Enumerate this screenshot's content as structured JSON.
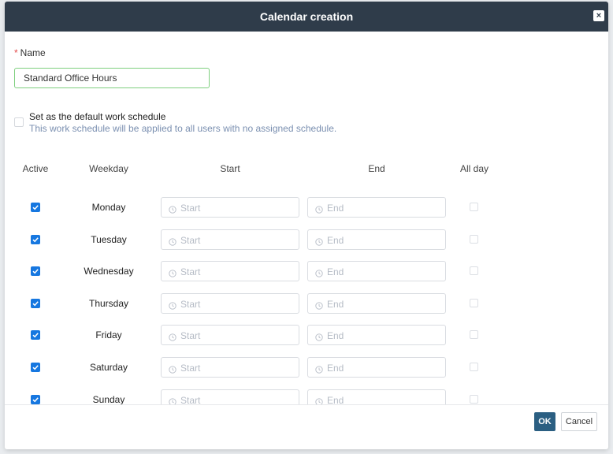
{
  "dialog": {
    "title": "Calendar creation",
    "close_label": "×"
  },
  "name_field": {
    "required_mark": "*",
    "label": "Name",
    "value": "Standard Office Hours"
  },
  "default_schedule": {
    "checked": false,
    "title": "Set as the default work schedule",
    "description": "This work schedule will be applied to all users with no assigned schedule."
  },
  "columns": {
    "active": "Active",
    "weekday": "Weekday",
    "start": "Start",
    "end": "End",
    "all_day": "All day"
  },
  "days": [
    {
      "name": "Monday",
      "active": true,
      "start_placeholder": "Start",
      "end_placeholder": "End",
      "all_day": false
    },
    {
      "name": "Tuesday",
      "active": true,
      "start_placeholder": "Start",
      "end_placeholder": "End",
      "all_day": false
    },
    {
      "name": "Wednesday",
      "active": true,
      "start_placeholder": "Start",
      "end_placeholder": "End",
      "all_day": false
    },
    {
      "name": "Thursday",
      "active": true,
      "start_placeholder": "Start",
      "end_placeholder": "End",
      "all_day": false
    },
    {
      "name": "Friday",
      "active": true,
      "start_placeholder": "Start",
      "end_placeholder": "End",
      "all_day": false
    },
    {
      "name": "Saturday",
      "active": true,
      "start_placeholder": "Start",
      "end_placeholder": "End",
      "all_day": false
    },
    {
      "name": "Sunday",
      "active": true,
      "start_placeholder": "Start",
      "end_placeholder": "End",
      "all_day": false
    }
  ],
  "footer": {
    "ok_label": "OK",
    "cancel_label": "Cancel"
  },
  "colors": {
    "header_bg": "#2f3c4a",
    "checkbox_accent": "#1677e0",
    "ok_button": "#2b5f82",
    "input_focus_border": "#7fcf7f"
  }
}
